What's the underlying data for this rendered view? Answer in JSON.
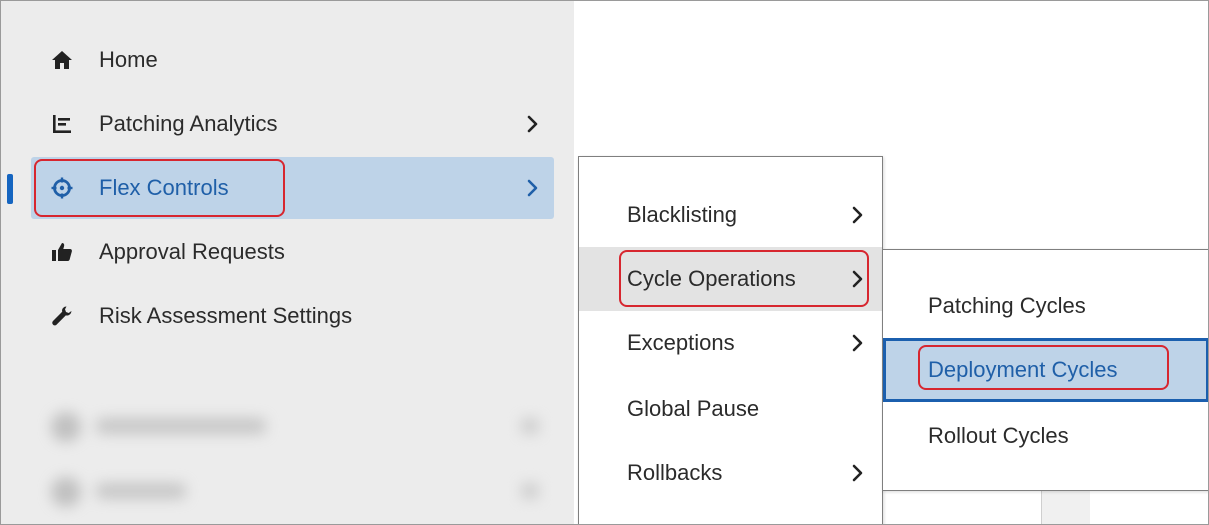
{
  "sidebar": {
    "items": [
      {
        "label": "Home",
        "icon": "home-icon",
        "has_submenu": false
      },
      {
        "label": "Patching Analytics",
        "icon": "analytics-icon",
        "has_submenu": true
      },
      {
        "label": "Flex Controls",
        "icon": "crosshair-icon",
        "has_submenu": true,
        "active": true
      },
      {
        "label": "Approval Requests",
        "icon": "thumbs-up-icon",
        "has_submenu": false
      },
      {
        "label": "Risk Assessment Settings",
        "icon": "wrench-icon",
        "has_submenu": false
      }
    ]
  },
  "flex_menu": {
    "items": [
      {
        "label": "Blacklisting",
        "has_submenu": true
      },
      {
        "label": "Cycle Operations",
        "has_submenu": true,
        "hovered": true
      },
      {
        "label": "Exceptions",
        "has_submenu": true
      },
      {
        "label": "Global Pause",
        "has_submenu": false
      },
      {
        "label": "Rollbacks",
        "has_submenu": true
      }
    ]
  },
  "cycle_menu": {
    "items": [
      {
        "label": "Patching Cycles"
      },
      {
        "label": "Deployment Cycles",
        "selected": true
      },
      {
        "label": "Rollout Cycles"
      }
    ]
  },
  "colors": {
    "active_bg": "#bed3e8",
    "active_text": "#1f5fa8",
    "highlight_border": "#d7262f",
    "sidebar_bg": "#ececec"
  }
}
